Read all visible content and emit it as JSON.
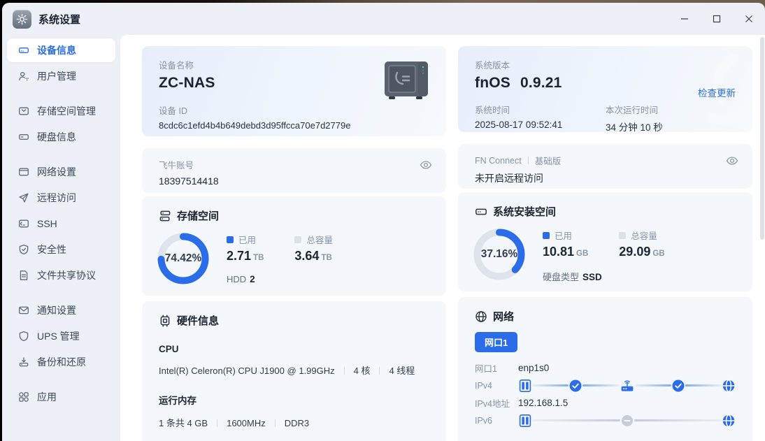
{
  "window": {
    "title": "系统设置"
  },
  "sidebar": {
    "groups": [
      {
        "items": [
          {
            "label": "设备信息"
          },
          {
            "label": "用户管理"
          }
        ]
      },
      {
        "items": [
          {
            "label": "存储空间管理"
          },
          {
            "label": "硬盘信息"
          }
        ]
      },
      {
        "items": [
          {
            "label": "网络设置"
          },
          {
            "label": "远程访问"
          },
          {
            "label": "SSH"
          },
          {
            "label": "安全性"
          },
          {
            "label": "文件共享协议"
          }
        ]
      },
      {
        "items": [
          {
            "label": "通知设置"
          },
          {
            "label": "UPS 管理"
          },
          {
            "label": "备份和还原"
          }
        ]
      },
      {
        "items": [
          {
            "label": "应用"
          }
        ]
      }
    ]
  },
  "device_card": {
    "name_label": "设备名称",
    "name": "ZC-NAS",
    "id_label": "设备 ID",
    "id": "8cdc6c1efd4b4b649debd3d95ffcca70e7d2779e"
  },
  "version_card": {
    "label": "系统版本",
    "os": "fnOS",
    "version": "0.9.21",
    "check_update": "检查更新",
    "time_label": "系统时间",
    "time": "2025-08-17 09:52:41",
    "uptime_label": "本次运行时间",
    "uptime": "34 分钟 10 秒"
  },
  "account_card": {
    "label": "飞牛账号",
    "value": "18397514418"
  },
  "connect_card": {
    "label": "FN Connect",
    "badge": "基础版",
    "value": "未开启远程访问"
  },
  "storage_card": {
    "title": "存储空间",
    "percent_text": "74.42%",
    "percent": 74.42,
    "used_label": "已用",
    "used": "2.71",
    "used_unit": "TB",
    "total_label": "总容量",
    "total": "3.64",
    "total_unit": "TB",
    "extra_label": "HDD",
    "extra_value": "2"
  },
  "system_card": {
    "title": "系统安装空间",
    "percent_text": "37.16%",
    "percent": 37.16,
    "used_label": "已用",
    "used": "10.81",
    "used_unit": "GB",
    "total_label": "总容量",
    "total": "29.09",
    "total_unit": "GB",
    "extra_label": "硬盘类型",
    "extra_value": "SSD"
  },
  "hardware_card": {
    "title": "硬件信息",
    "cpu_label": "CPU",
    "cpu_items": [
      "Intel(R) Celeron(R) CPU J1900 @ 1.99GHz",
      "4 核",
      "4 线程"
    ],
    "ram_label": "运行内存",
    "ram_items": [
      "1 条共 4 GB",
      "1600MHz",
      "DDR3"
    ]
  },
  "network_card": {
    "title": "网络",
    "port_button": "网口1",
    "port_label": "网口1",
    "port_value": "enp1s0",
    "ipv4_label": "IPv4",
    "ipv4_addr_label": "IPv4地址",
    "ipv4_addr": "192.168.1.5",
    "ipv6_label": "IPv6"
  },
  "colors": {
    "accent": "#2b6ce8",
    "track": "#dee4ec",
    "used_blue": "#2b6ce8",
    "total_gray": "#dbe1e9"
  }
}
